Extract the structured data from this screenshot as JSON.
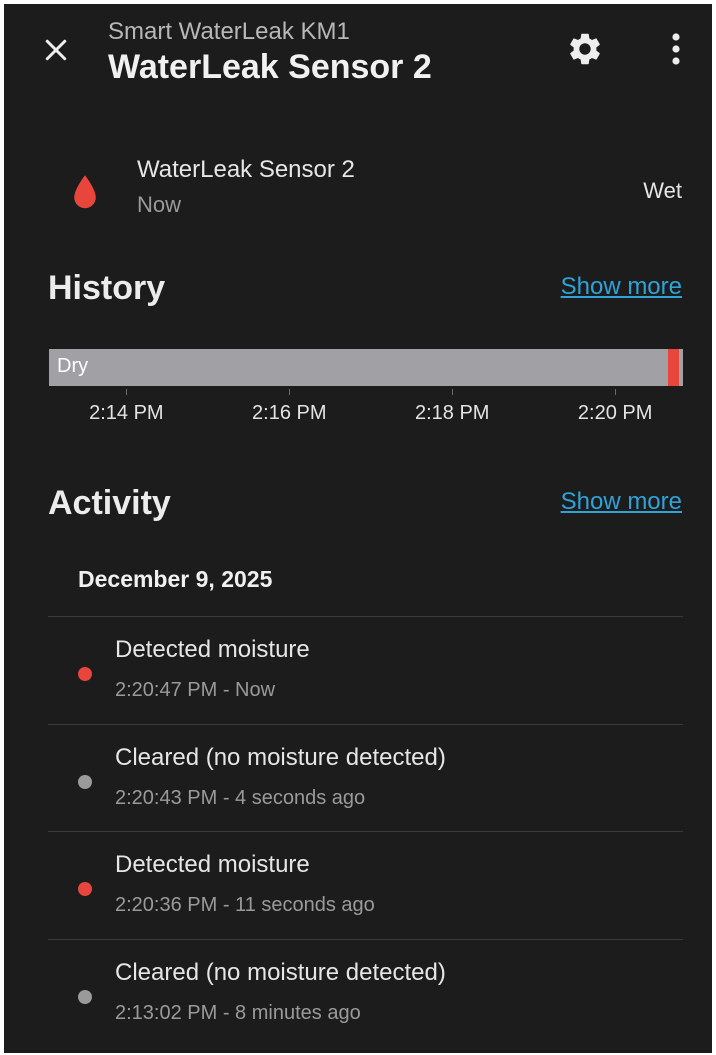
{
  "header": {
    "device_name": "Smart WaterLeak KM1",
    "entity_title": "WaterLeak Sensor 2",
    "close_icon": "close-icon",
    "settings_icon": "gear-icon",
    "menu_icon": "more-vertical-icon"
  },
  "entity": {
    "name": "WaterLeak Sensor 2",
    "last_changed": "Now",
    "state": "Wet",
    "icon": "water-drop-icon",
    "icon_color": "#e8453c"
  },
  "history": {
    "title": "History",
    "show_more": "Show more",
    "segments": [
      {
        "label": "Dry",
        "start_fraction": 0.0,
        "end_fraction": 0.976,
        "color": "#a1a1a5"
      },
      {
        "label": "",
        "start_fraction": 0.976,
        "end_fraction": 0.993,
        "color": "#e8453c"
      },
      {
        "label": "",
        "start_fraction": 0.993,
        "end_fraction": 1.0,
        "color": "#a1a1a5"
      }
    ],
    "ticks": [
      {
        "label": "2:14 PM",
        "fraction": 0.122
      },
      {
        "label": "2:16 PM",
        "fraction": 0.379
      },
      {
        "label": "2:18 PM",
        "fraction": 0.636
      },
      {
        "label": "2:20 PM",
        "fraction": 0.893
      }
    ]
  },
  "activity": {
    "title": "Activity",
    "show_more": "Show more",
    "date": "December 9, 2025",
    "entries": [
      {
        "message": "Detected moisture",
        "time": "2:20:47 PM - Now",
        "dot_color": "#e8453c"
      },
      {
        "message": "Cleared (no moisture detected)",
        "time": "2:20:43 PM - 4 seconds ago",
        "dot_color": "#9a9a9a"
      },
      {
        "message": "Detected moisture",
        "time": "2:20:36 PM - 11 seconds ago",
        "dot_color": "#e8453c"
      },
      {
        "message": "Cleared (no moisture detected)",
        "time": "2:13:02 PM - 8 minutes ago",
        "dot_color": "#9a9a9a"
      }
    ]
  },
  "colors": {
    "background": "#1c1c1c",
    "link": "#2fa2d8",
    "wet": "#e8453c",
    "dry": "#a1a1a5"
  }
}
